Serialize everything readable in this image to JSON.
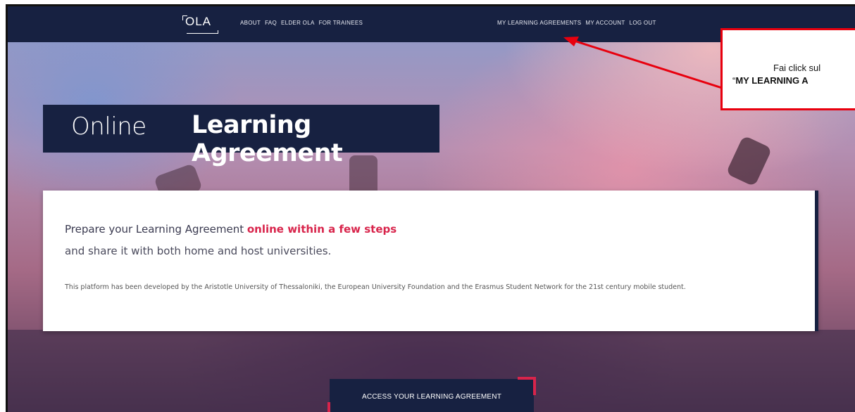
{
  "brand": {
    "logo_text": "OLA"
  },
  "nav": {
    "left_links": [
      "ABOUT",
      "FAQ",
      "ELDER OLA",
      "FOR TRAINEES"
    ],
    "right_links": [
      "MY LEARNING AGREEMENTS",
      "MY ACCOUNT",
      "LOG OUT"
    ]
  },
  "hero": {
    "title_light": "Online",
    "title_bold": "Learning Agreement"
  },
  "intro": {
    "lead_prefix": "Prepare your Learning Agreement ",
    "lead_emphasis": "online within a few steps",
    "lead_line2": "and share it with both home and host universities.",
    "description": "This platform has been developed by the Aristotle University of Thessaloniki, the European University Foundation and the Erasmus Student Network for the 21st century mobile student."
  },
  "cta": {
    "label": "ACCESS YOUR LEARNING AGREEMENT"
  },
  "annotation": {
    "line1": "Fai click sul",
    "line2_open_quote": "“",
    "line2_bold": "MY LEARNING A"
  },
  "colors": {
    "navy": "#172141",
    "accent_red": "#d8244b",
    "callout_red": "#e8000e"
  }
}
